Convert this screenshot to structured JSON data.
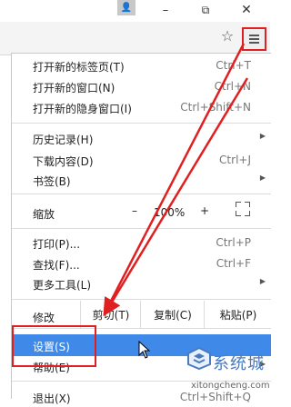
{
  "titlebar": {
    "minimize": "–",
    "restore": "⧉",
    "close": "✕",
    "user": "👤"
  },
  "toolbar": {
    "star": "☆"
  },
  "menu": {
    "items": [
      {
        "label": "打开新的标签页(T)",
        "shortcut": "Ctrl+T"
      },
      {
        "label": "打开新的窗口(N)",
        "shortcut": "Ctrl+N"
      },
      {
        "label": "打开新的隐身窗口(I)",
        "shortcut": "Ctrl+Shift+N"
      },
      {
        "label": "历史记录(H)",
        "shortcut": ""
      },
      {
        "label": "下载内容(D)",
        "shortcut": "Ctrl+J"
      },
      {
        "label": "书签(B)",
        "shortcut": ""
      },
      {
        "label": "打印(P)...",
        "shortcut": "Ctrl+P"
      },
      {
        "label": "查找(F)...",
        "shortcut": "Ctrl+F"
      },
      {
        "label": "更多工具(L)",
        "shortcut": ""
      },
      {
        "label": "设置(S)",
        "shortcut": ""
      },
      {
        "label": "帮助(E)",
        "shortcut": ""
      },
      {
        "label": "退出(X)",
        "shortcut": "Ctrl+Shift+Q"
      }
    ],
    "zoom": {
      "label": "缩放",
      "minus": "–",
      "value": "100%",
      "plus": "+"
    },
    "edit": {
      "label": "修改",
      "cut": "剪切(T)",
      "copy": "复制(C)",
      "paste": "粘贴(P)"
    }
  },
  "watermark": {
    "brand": "系统城",
    "url": "xitongcheng.com"
  },
  "colors": {
    "highlight": "#3f8ae8",
    "annotation": "#e02020",
    "brand": "#4a7bbf"
  }
}
